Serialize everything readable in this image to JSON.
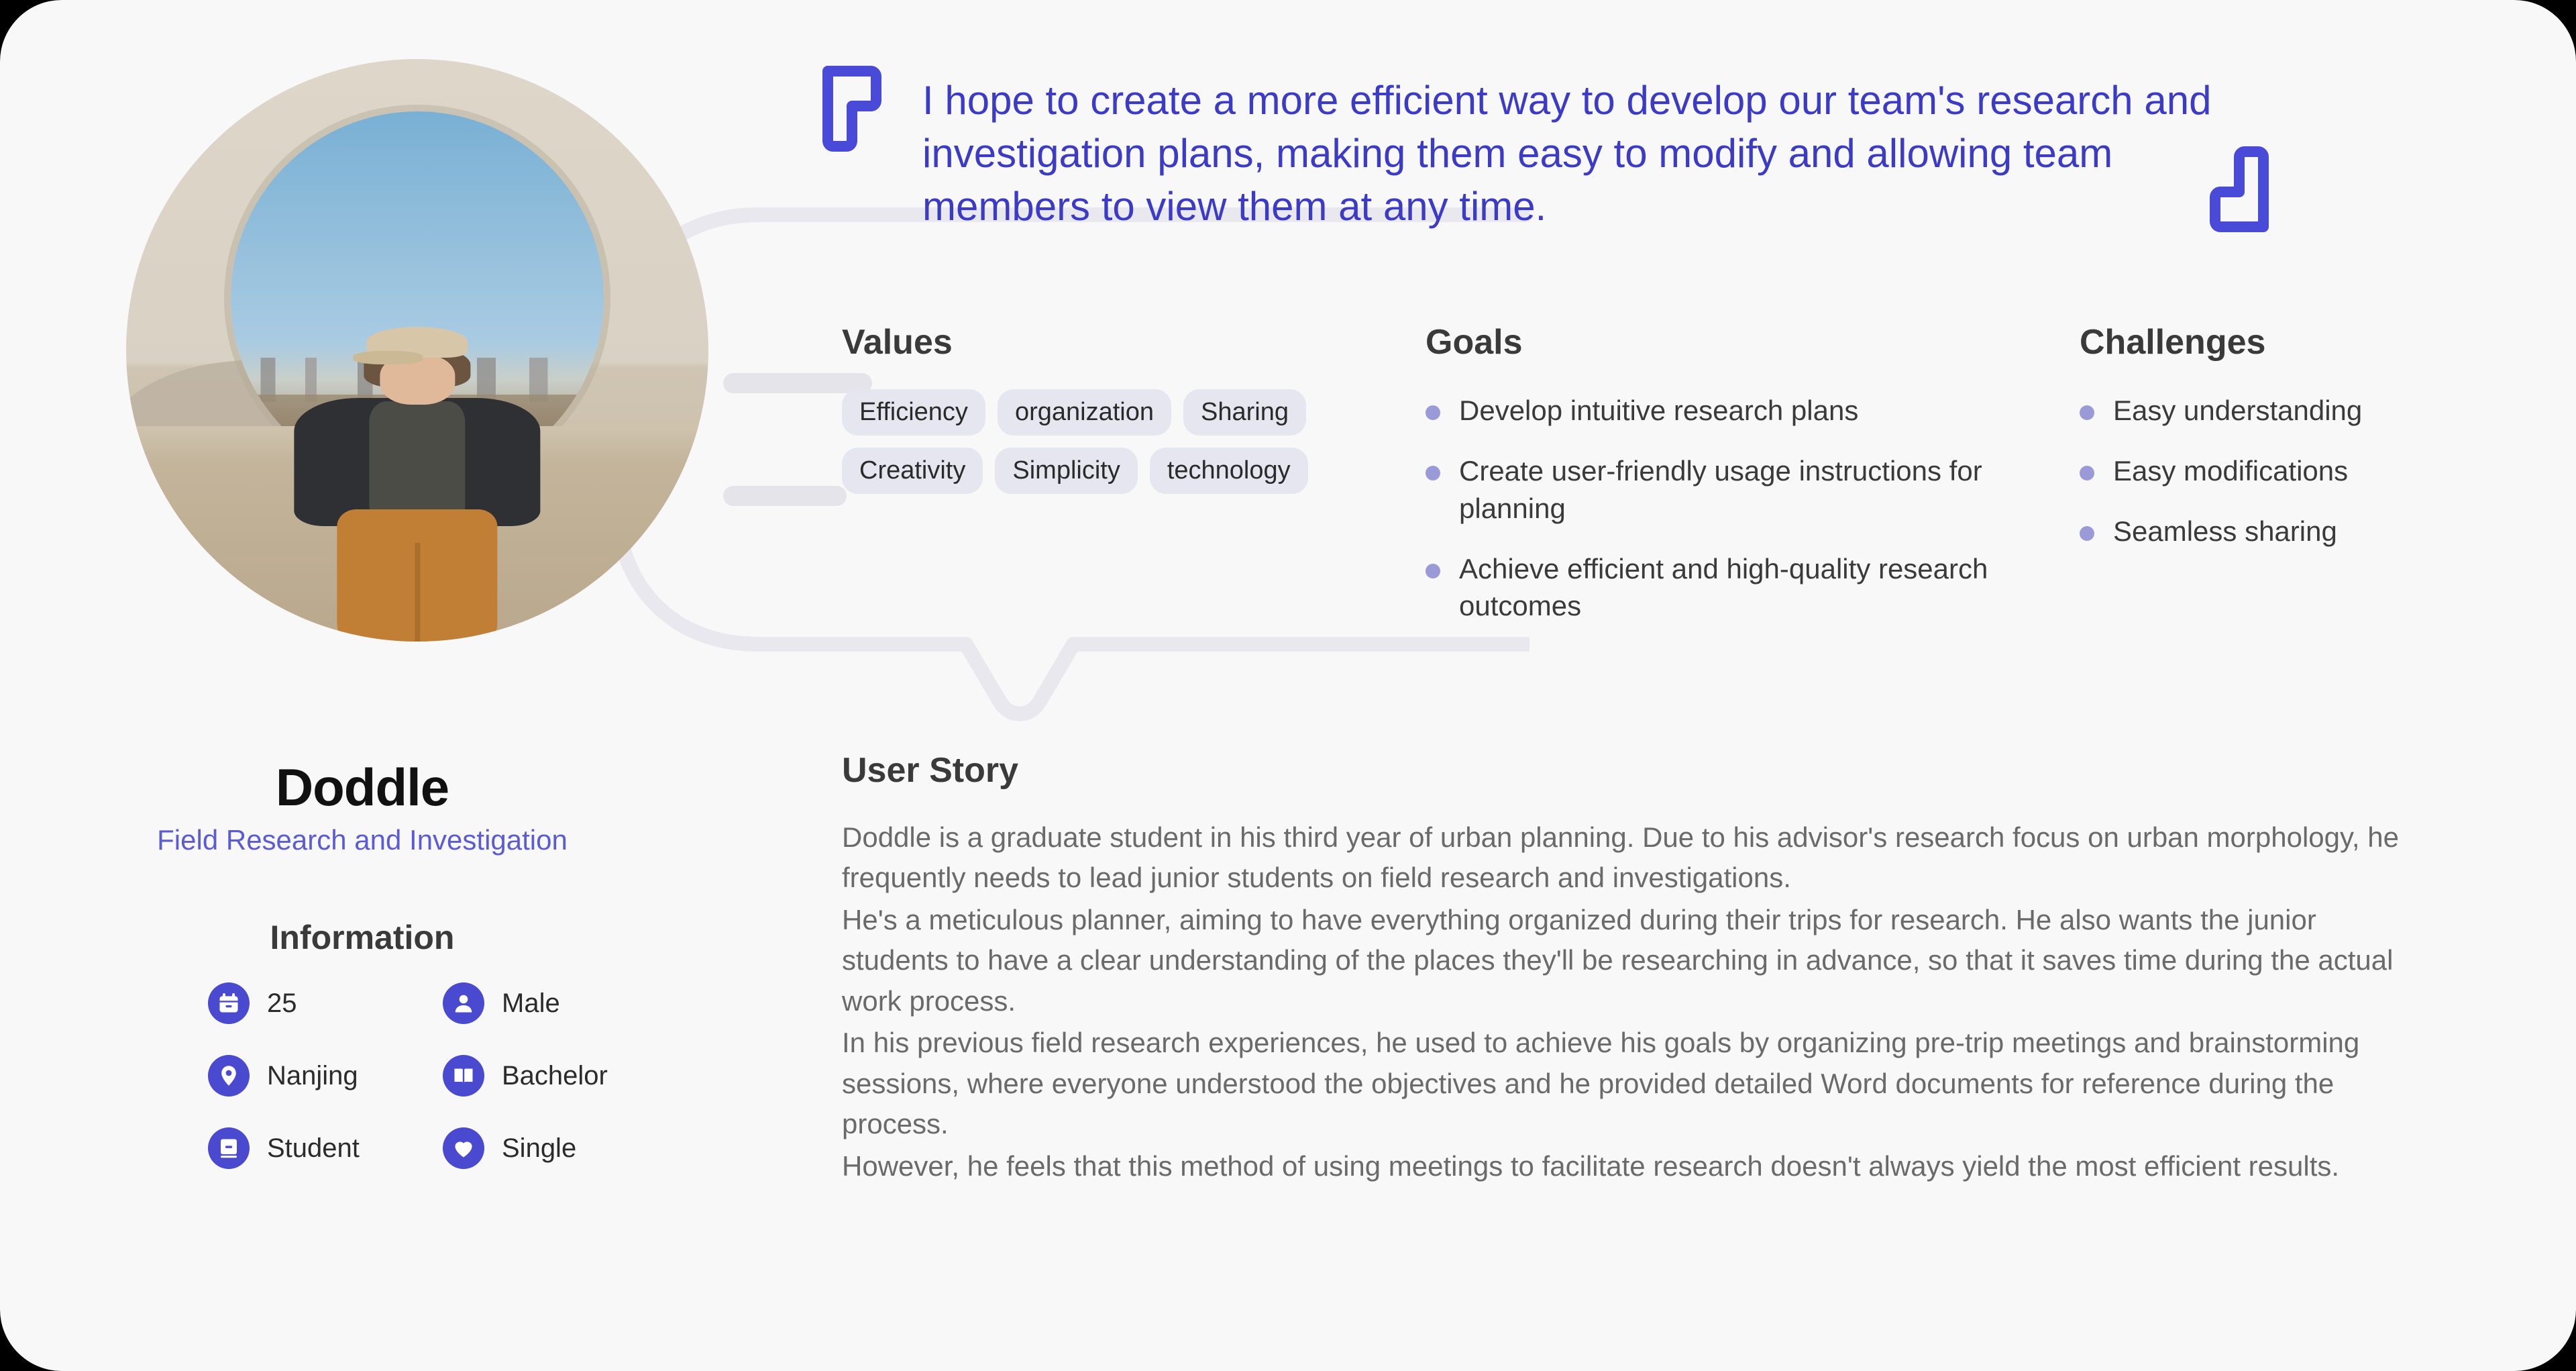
{
  "persona": {
    "name": "Doddle",
    "subtitle": "Field Research and Investigation",
    "information_title": "Information",
    "information": [
      {
        "icon": "calendar-icon",
        "label": "25"
      },
      {
        "icon": "person-icon",
        "label": "Male"
      },
      {
        "icon": "location-pin-icon",
        "label": "Nanjing"
      },
      {
        "icon": "book-icon",
        "label": "Bachelor"
      },
      {
        "icon": "id-card-icon",
        "label": "Student"
      },
      {
        "icon": "heart-icon",
        "label": "Single"
      }
    ]
  },
  "quote": {
    "text": "I hope to create a more efficient way to develop our team's research and investigation plans, making them easy to modify and allowing team members to view them at any time.",
    "open_mark_icon": "quote-open-icon",
    "close_mark_icon": "quote-close-icon"
  },
  "values": {
    "title": "Values",
    "tags": [
      "Efficiency",
      "organization",
      "Sharing",
      "Creativity",
      "Simplicity",
      "technology"
    ]
  },
  "goals": {
    "title": "Goals",
    "items": [
      "Develop intuitive research plans",
      "Create user-friendly usage instructions for planning",
      "Achieve efficient and high-quality research outcomes"
    ]
  },
  "challenges": {
    "title": "Challenges",
    "items": [
      "Easy understanding",
      "Easy modifications",
      "Seamless sharing"
    ]
  },
  "user_story": {
    "title": "User Story",
    "paragraphs": [
      "Doddle is a graduate student in his third year of urban planning. Due to his advisor's research focus on urban morphology, he frequently needs to lead junior students on field research and investigations.",
      "He's a meticulous planner, aiming to have everything organized during their trips for research. He also wants the junior students to have a clear understanding of the places they'll be researching in advance, so that it saves time during the actual work process.",
      "In his previous field research experiences, he used to achieve his goals by organizing pre-trip meetings and brainstorming sessions, where everyone understood the objectives and he provided detailed Word documents for reference during the process.",
      "However, he feels that this method of using meetings to facilitate research doesn't always yield the most efficient results."
    ]
  },
  "colors": {
    "card_background": "#f8f8f8",
    "accent_blue": "#4a4ad0",
    "quote_blue": "#3b3bc8",
    "subtitle_blue": "#5b5bd6",
    "tag_background": "#e6e6f0",
    "bullet": "#9a9ad8",
    "bubble_outline": "#e4e4ea",
    "heading": "#3a3a3a",
    "body_text": "#6a6a6a"
  }
}
